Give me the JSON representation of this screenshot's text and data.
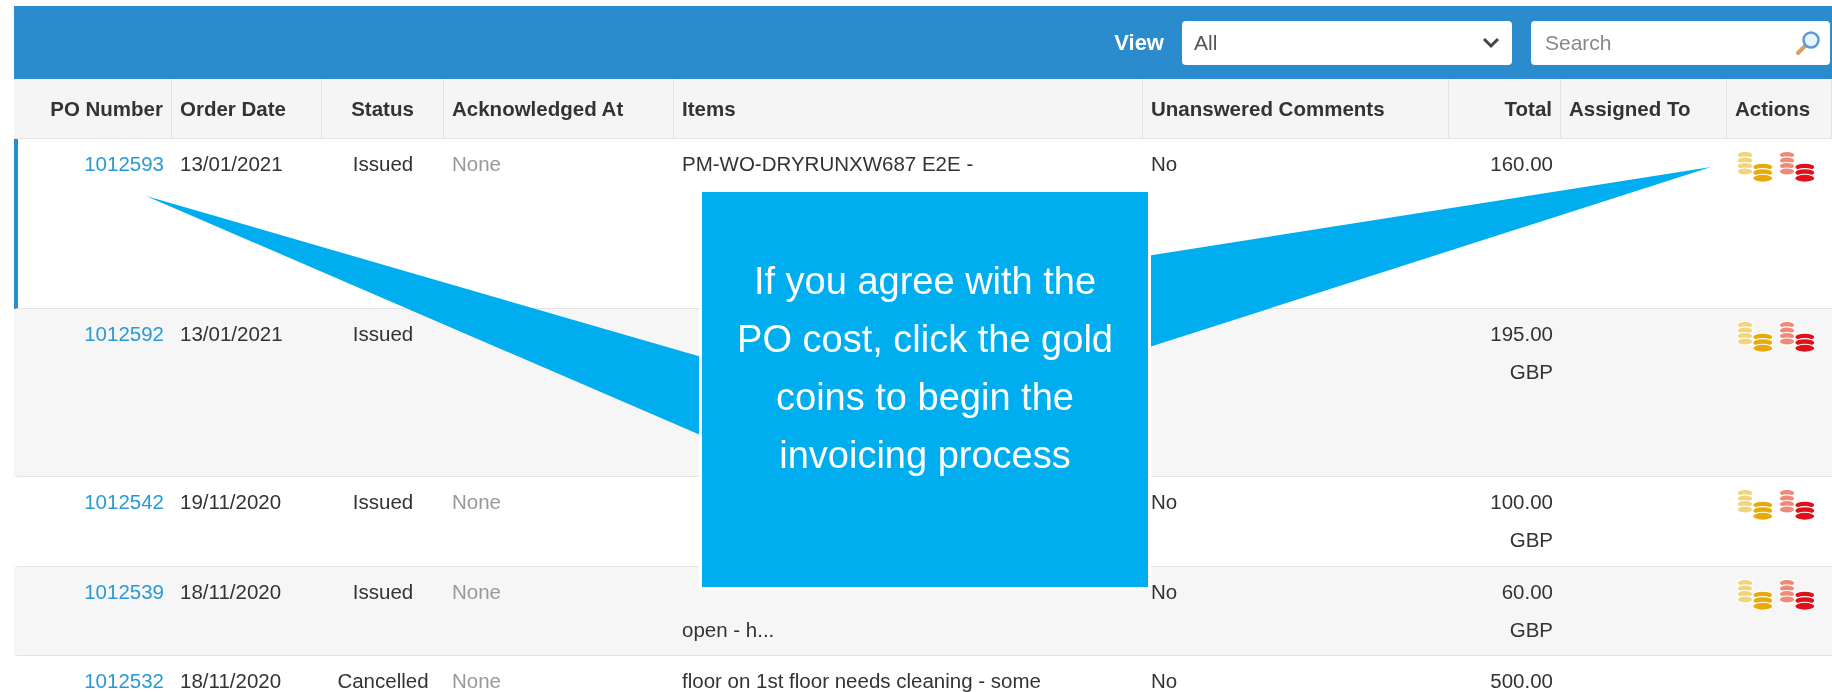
{
  "toolbar": {
    "view_label": "View",
    "view_select": {
      "value": "All"
    },
    "search": {
      "placeholder": "Search"
    }
  },
  "table": {
    "columns": [
      {
        "label": "PO Number"
      },
      {
        "label": "Order Date"
      },
      {
        "label": "Status"
      },
      {
        "label": "Acknowledged At"
      },
      {
        "label": "Items"
      },
      {
        "label": "Unanswered Comments"
      },
      {
        "label": "Total"
      },
      {
        "label": "Assigned To"
      },
      {
        "label": "Actions"
      }
    ],
    "rows": [
      {
        "selected": true,
        "po_number": "1012593",
        "order_date": "13/01/2021",
        "status": "Issued",
        "acknowledged_at": "None",
        "items": "PM-WO-DRYRUNXW687 E2E -",
        "unanswered_comments": "No",
        "total": "160.00",
        "actions": [
          {
            "kind": "gold-coins"
          },
          {
            "kind": "red-coins"
          }
        ]
      },
      {
        "selected": false,
        "po_number": "1012592",
        "order_date": "13/01/2021",
        "status": "Issued",
        "total": "195.00",
        "currency": "GBP",
        "actions": [
          {
            "kind": "gold-coins"
          },
          {
            "kind": "red-coins"
          }
        ]
      },
      {
        "selected": false,
        "po_number": "1012542",
        "order_date": "19/11/2020",
        "status": "Issued",
        "acknowledged_at": "None",
        "unanswered_comments": "No",
        "total": "100.00",
        "currency": "GBP",
        "actions": [
          {
            "kind": "gold-coins"
          },
          {
            "kind": "red-coins"
          }
        ]
      },
      {
        "selected": false,
        "po_number": "1012539",
        "order_date": "18/11/2020",
        "status": "Issued",
        "acknowledged_at": "None",
        "items_continued": "open - h...",
        "unanswered_comments": "No",
        "total": "60.00",
        "currency": "GBP",
        "actions": [
          {
            "kind": "gold-coins"
          },
          {
            "kind": "red-coins"
          }
        ]
      },
      {
        "selected": false,
        "po_number": "1012532",
        "order_date": "18/11/2020",
        "status": "Cancelled",
        "acknowledged_at": "None",
        "items": "floor on 1st floor needs cleaning - some",
        "unanswered_comments": "No",
        "total": "500.00"
      }
    ]
  },
  "callout": {
    "text": "If you agree with the PO cost, click the gold coins to begin the invoicing process"
  }
}
